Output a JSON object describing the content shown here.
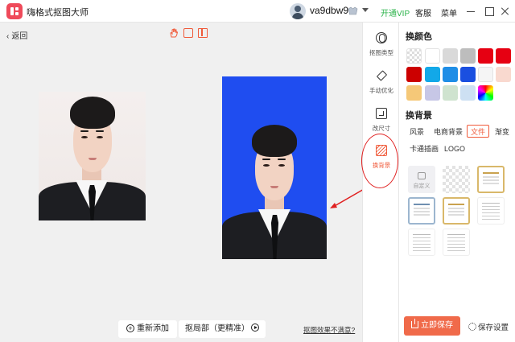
{
  "app": {
    "title": "嗨格式抠图大师",
    "username": "va9dbw9",
    "open_vip": "开通VIP",
    "service": "客服",
    "menu": "菜单"
  },
  "canvas": {
    "back_label": "返回",
    "add_again": "重新添加",
    "partial_cutout": "抠局部（更精准）",
    "unhappy_link": "抠图效果不满意?"
  },
  "sidetools": [
    {
      "label": "抠图类型",
      "icon": "cutout-type-icon"
    },
    {
      "label": "手动优化",
      "icon": "eraser-icon"
    },
    {
      "label": "改尺寸",
      "icon": "resize-icon"
    },
    {
      "label": "换背景",
      "icon": "change-background-icon",
      "active": true
    }
  ],
  "panel": {
    "color_title": "换颜色",
    "colors": [
      "transparent",
      "#ffffff",
      "#d9d9d9",
      "#bdbdbd",
      "#e60012",
      "#e60012",
      "#cc0000",
      "#12a8e8",
      "#1f8ee6",
      "#1a4fe0",
      "#f5f5f5",
      "#f9d9cf",
      "#f5c878",
      "#c7c7e6",
      "#cfe3cf",
      "#cde0f3",
      "gradient"
    ],
    "bg_title": "换背景",
    "tags": [
      "风景",
      "电商背景",
      "文件",
      "渐变",
      "卡通插画",
      "LOGO"
    ],
    "active_tag": "文件",
    "custom_label": "自定义",
    "save_now": "立即保存",
    "save_settings": "保存设置"
  },
  "colors": {
    "accent": "#f05a3a",
    "vip_green": "#2bb34a",
    "result_bg": "#1f4df0",
    "annotation_red": "#e02020"
  }
}
